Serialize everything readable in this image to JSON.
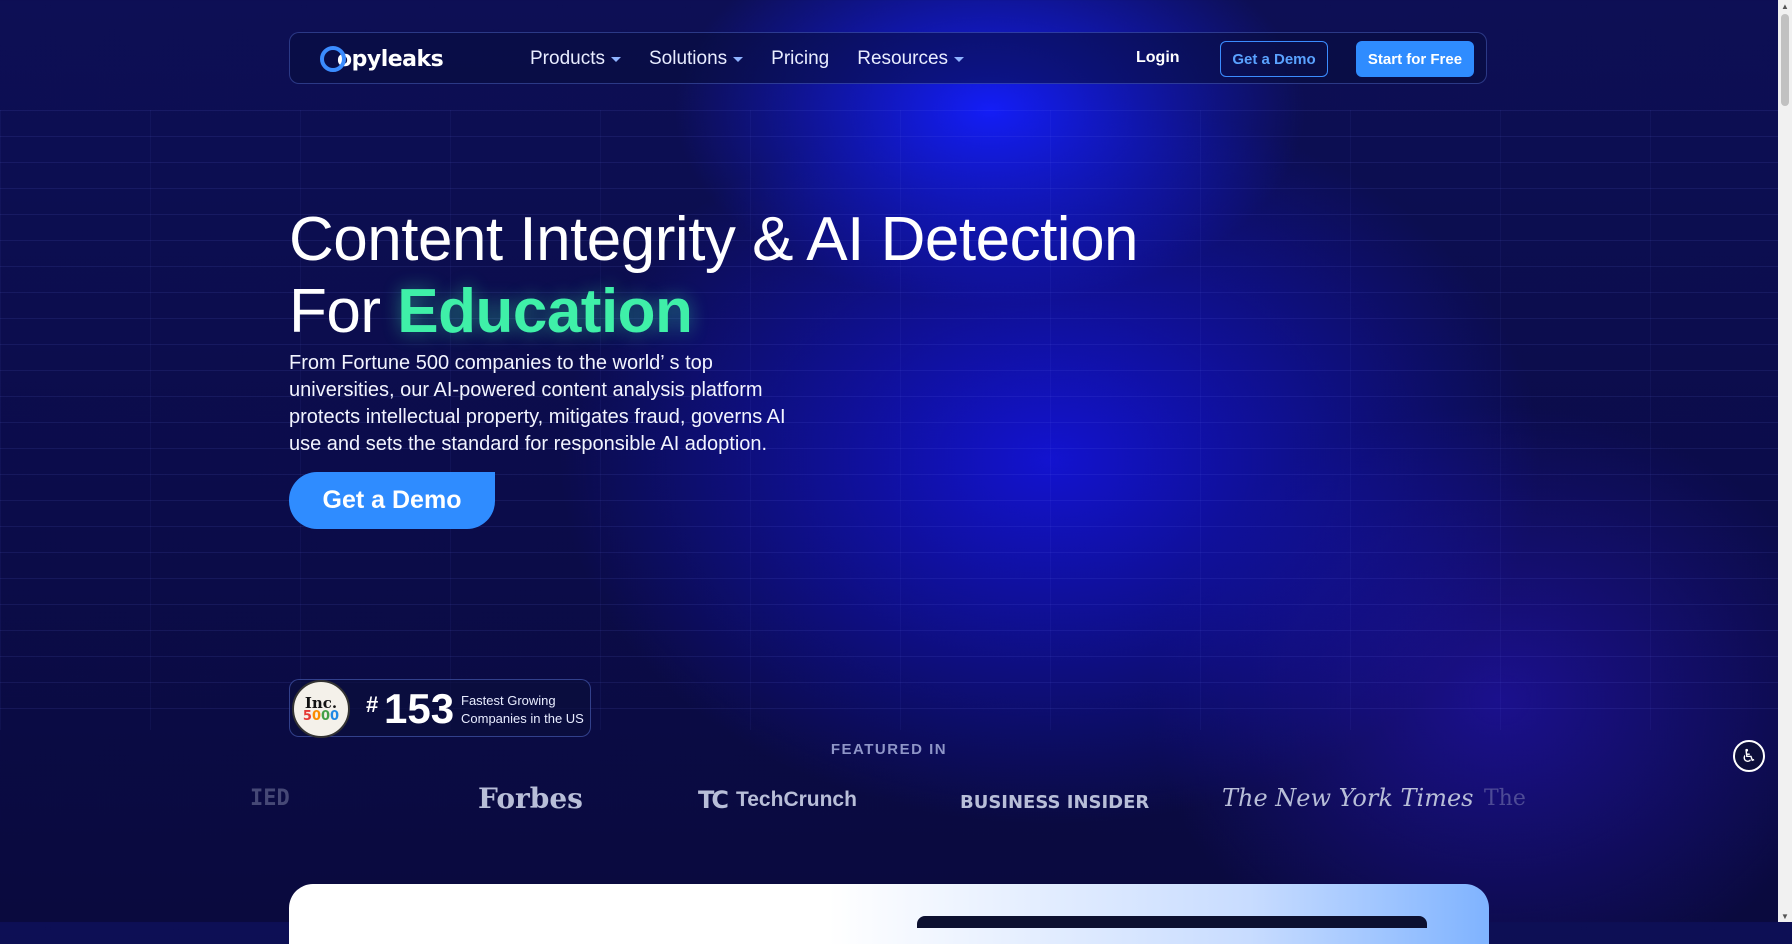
{
  "nav": {
    "logo_text": "opyleaks",
    "menu": [
      {
        "label": "Products",
        "has_dropdown": true
      },
      {
        "label": "Solutions",
        "has_dropdown": true
      },
      {
        "label": "Pricing",
        "has_dropdown": false
      },
      {
        "label": "Resources",
        "has_dropdown": true
      }
    ],
    "login_label": "Login",
    "demo_label": "Get a Demo",
    "start_label": "Start for Free"
  },
  "hero": {
    "title_line1": "Content Integrity & AI Detection",
    "title_line2_prefix": "For ",
    "title_line2_accent": "Education",
    "description": "From Fortune 500 companies to the world’ s top universities, our AI-powered content analysis platform protects intellectual property, mitigates fraud, governs AI use and sets the standard for responsible AI adoption.",
    "cta_label": "Get a Demo"
  },
  "badge": {
    "logo_word": "Inc.",
    "logo_number": [
      "5",
      "0",
      "0",
      "0"
    ],
    "hash": "#",
    "rank": "153",
    "label_line1": "Fastest Growing",
    "label_line2": "Companies in the US"
  },
  "featured": {
    "heading": "FEATURED IN",
    "logos": [
      "IED",
      "Forbes",
      "TechCrunch",
      "BUSINESS INSIDER",
      "The New York Times",
      "The"
    ]
  },
  "icons": {
    "caret": "chevron-down-icon",
    "accessibility": "accessibility-icon",
    "accessibility_glyph": "♿"
  },
  "colors": {
    "accent_green": "#3ff0a8",
    "brand_blue": "#2f8cff",
    "background": "#0d0f55"
  }
}
